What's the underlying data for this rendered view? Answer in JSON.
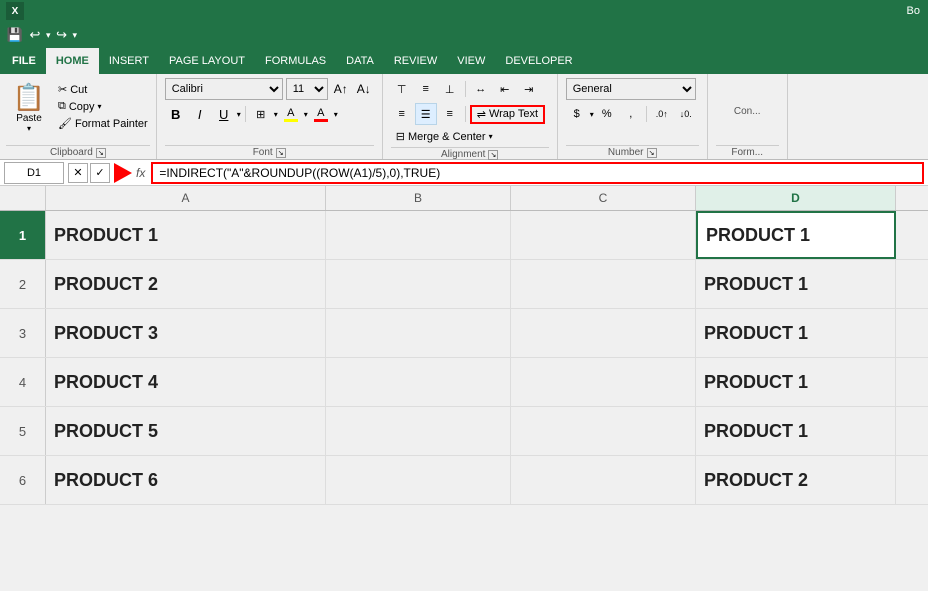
{
  "titlebar": {
    "text": "Bo"
  },
  "quickaccess": {
    "save_label": "💾",
    "undo_label": "↩",
    "redo_label": "↪"
  },
  "tabs": [
    {
      "label": "FILE",
      "active": false
    },
    {
      "label": "HOME",
      "active": true
    },
    {
      "label": "INSERT",
      "active": false
    },
    {
      "label": "PAGE LAYOUT",
      "active": false
    },
    {
      "label": "FORMULAS",
      "active": false
    },
    {
      "label": "DATA",
      "active": false
    },
    {
      "label": "REVIEW",
      "active": false
    },
    {
      "label": "VIEW",
      "active": false
    },
    {
      "label": "DEVELOPER",
      "active": false
    }
  ],
  "clipboard": {
    "paste_label": "Paste",
    "cut_label": "Cut",
    "copy_label": "Copy",
    "format_painter_label": "Format Painter",
    "group_label": "Clipboard"
  },
  "font": {
    "name": "Calibri",
    "size": "11",
    "bold_label": "B",
    "italic_label": "I",
    "underline_label": "U",
    "group_label": "Font"
  },
  "alignment": {
    "wrap_text_label": "Wrap Text",
    "merge_center_label": "Merge & Center",
    "group_label": "Alignment"
  },
  "number": {
    "format": "General",
    "group_label": "Number"
  },
  "formulabar": {
    "cell_ref": "D1",
    "formula": "=INDIRECT(\"A\"&ROUNDUP((ROW(A1)/5),0),TRUE)"
  },
  "columns": [
    "A",
    "B",
    "C",
    "D"
  ],
  "rows": [
    {
      "num": "1",
      "cells": [
        "PRODUCT 1",
        "",
        "",
        "PRODUCT 1"
      ],
      "selected": true
    },
    {
      "num": "2",
      "cells": [
        "PRODUCT 2",
        "",
        "",
        "PRODUCT 1"
      ],
      "selected": false
    },
    {
      "num": "3",
      "cells": [
        "PRODUCT 3",
        "",
        "",
        "PRODUCT 1"
      ],
      "selected": false
    },
    {
      "num": "4",
      "cells": [
        "PRODUCT 4",
        "",
        "",
        "PRODUCT 1"
      ],
      "selected": false
    },
    {
      "num": "5",
      "cells": [
        "PRODUCT 5",
        "",
        "",
        "PRODUCT 1"
      ],
      "selected": false
    },
    {
      "num": "6",
      "cells": [
        "PRODUCT 6",
        "",
        "",
        "PRODUCT 2"
      ],
      "selected": false
    }
  ]
}
